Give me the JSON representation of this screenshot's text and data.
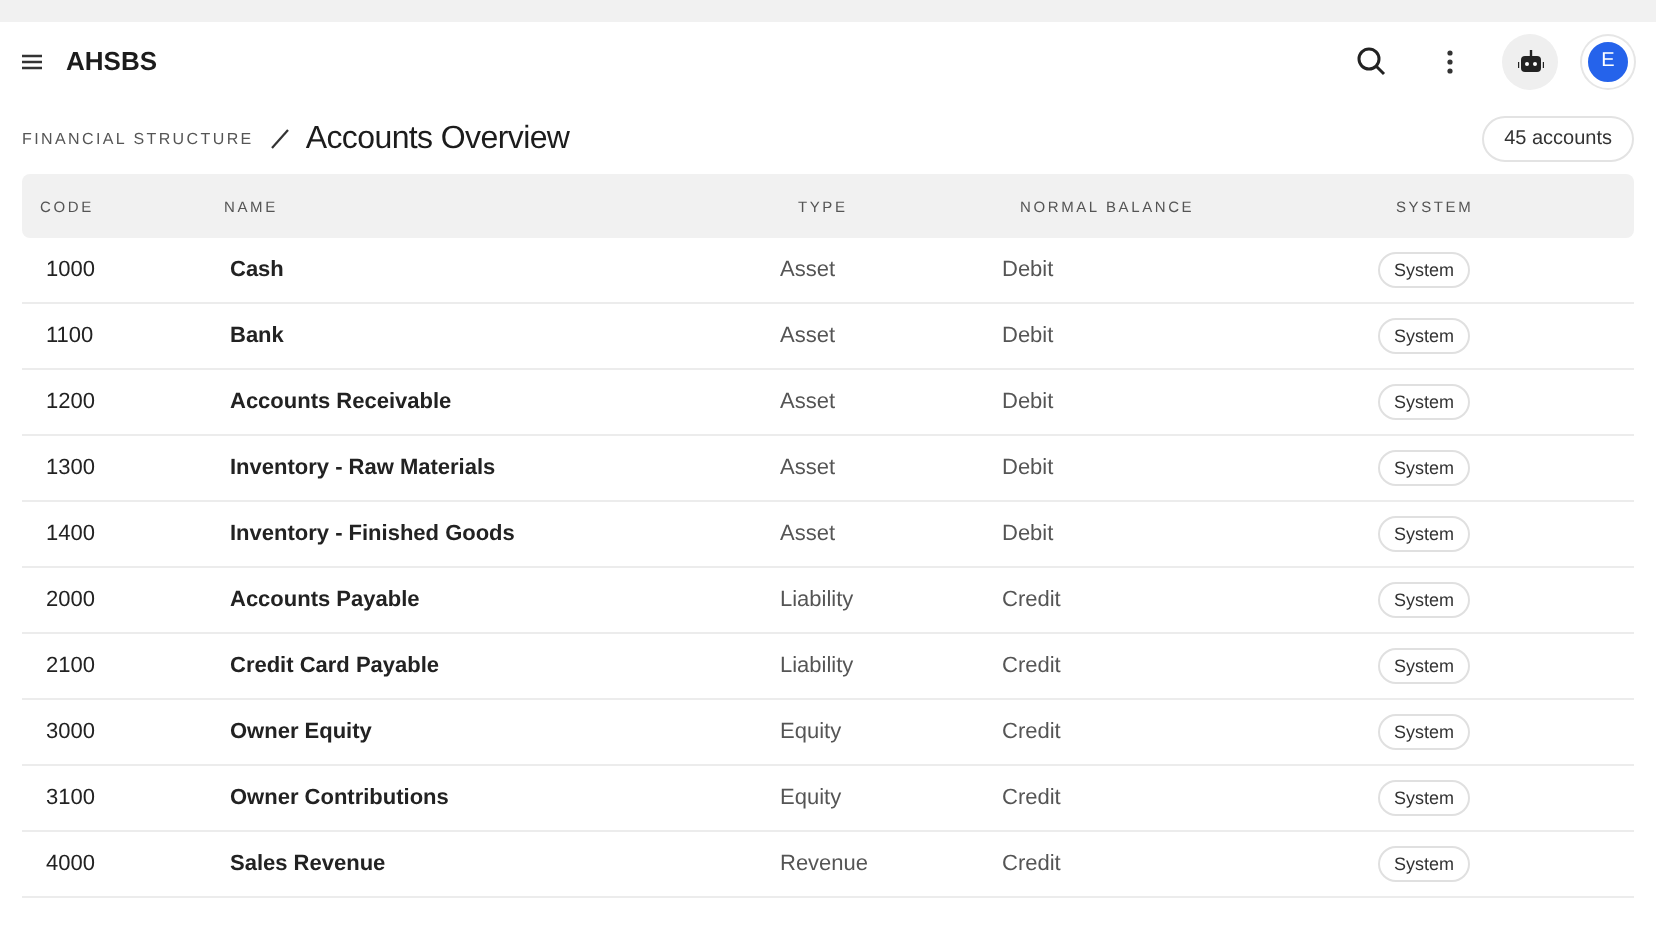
{
  "app_bar": {
    "title": "AHSBS",
    "avatar": "E"
  },
  "page": {
    "breadcrumb": "FINANCIAL STRUCTURE",
    "title": "Accounts Overview",
    "count": "45 accounts"
  },
  "table": {
    "columns": [
      "CODE",
      "NAME",
      "TYPE",
      "NORMAL BALANCE",
      "SYSTEM"
    ],
    "rows": [
      {
        "code": "1000",
        "name": "Cash",
        "type": "Asset",
        "balance": "Debit",
        "system": "System"
      },
      {
        "code": "1100",
        "name": "Bank",
        "type": "Asset",
        "balance": "Debit",
        "system": "System"
      },
      {
        "code": "1200",
        "name": "Accounts Receivable",
        "type": "Asset",
        "balance": "Debit",
        "system": "System"
      },
      {
        "code": "1300",
        "name": "Inventory - Raw Materials",
        "type": "Asset",
        "balance": "Debit",
        "system": "System"
      },
      {
        "code": "1400",
        "name": "Inventory - Finished Goods",
        "type": "Asset",
        "balance": "Debit",
        "system": "System"
      },
      {
        "code": "2000",
        "name": "Accounts Payable",
        "type": "Liability",
        "balance": "Credit",
        "system": "System"
      },
      {
        "code": "2100",
        "name": "Credit Card Payable",
        "type": "Liability",
        "balance": "Credit",
        "system": "System"
      },
      {
        "code": "3000",
        "name": "Owner Equity",
        "type": "Equity",
        "balance": "Credit",
        "system": "System"
      },
      {
        "code": "3100",
        "name": "Owner Contributions",
        "type": "Equity",
        "balance": "Credit",
        "system": "System"
      },
      {
        "code": "4000",
        "name": "Sales Revenue",
        "type": "Revenue",
        "balance": "Credit",
        "system": "System"
      }
    ]
  }
}
